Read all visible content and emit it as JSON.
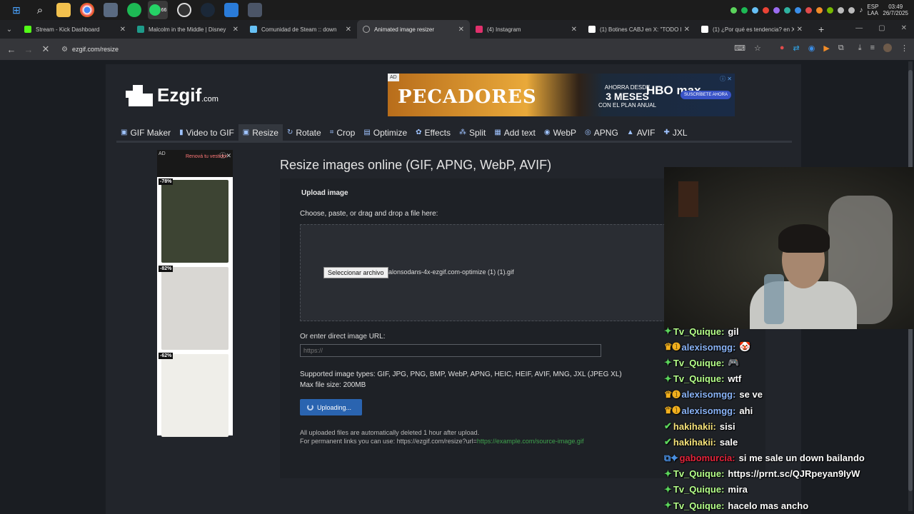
{
  "tray": {
    "lang": "ESP",
    "layout": "LAA",
    "time": "03:49",
    "date": "26/7/2025"
  },
  "taskbar_badge": "66",
  "tabs": [
    {
      "label": "Stream - Kick Dashboard",
      "color": "#53fc18"
    },
    {
      "label": "Malcolm in the Middle | Disney",
      "color": "#1e9b8a"
    },
    {
      "label": "Comunidad de Steam :: down",
      "color": "#66c0f4"
    },
    {
      "label": "Animated image resizer",
      "color": "#aaaaaa"
    },
    {
      "label": "(4) Instagram",
      "color": "#e1306c"
    },
    {
      "label": "(1) Botines CABJ en X: \"TODO I",
      "color": "#ffffff"
    },
    {
      "label": "(1) ¿Por qué es tendencia? en X",
      "color": "#ffffff"
    }
  ],
  "url": "ezgif.com/resize",
  "site": {
    "logo": "Ezgif",
    "logo_sub": ".com",
    "ad_tag": "AD",
    "ad_title": "PECADORES",
    "ad_promo_top": "AHORRA DESDE",
    "ad_promo_main": "3 MESES",
    "ad_promo_bottom": "CON EL PLAN ANUAL",
    "ad_brand": "HBO max",
    "ad_cta": "SUSCRÍBETE AHORA",
    "menu": [
      {
        "label": "GIF Maker"
      },
      {
        "label": "Video to GIF"
      },
      {
        "label": "Resize"
      },
      {
        "label": "Rotate"
      },
      {
        "label": "Crop"
      },
      {
        "label": "Optimize"
      },
      {
        "label": "Effects"
      },
      {
        "label": "Split"
      },
      {
        "label": "Add text"
      },
      {
        "label": "WebP"
      },
      {
        "label": "APNG"
      },
      {
        "label": "AVIF"
      },
      {
        "label": "JXL"
      }
    ],
    "side_ad": {
      "tag": "AD",
      "brand": "Renová tu vestidor",
      "products": [
        {
          "discount": "-78%",
          "color": "#3d4433"
        },
        {
          "discount": "-82%",
          "color": "#d9d7d3"
        },
        {
          "discount": "-62%",
          "color": "#efeee9"
        }
      ]
    },
    "page_title": "Resize images online (GIF, APNG, WebP, AVIF)",
    "upload_label": "Upload image",
    "choose_text": "Choose, paste, or drag and drop a file here:",
    "file_button": "Seleccionar archivo",
    "file_name": "alonsodans-4x-ezgif.com-optimize (1) (1).gif",
    "url_label": "Or enter direct image URL:",
    "url_placeholder": "https://",
    "supported": "Supported image types: GIF, JPG, PNG, BMP, WebP, APNG, HEIC, HEIF, AVIF, MNG, JXL (JPEG XL)",
    "max_size": "Max file size: 200MB",
    "upload_button": "Uploading...",
    "note1": "All uploaded files are automatically deleted 1 hour after upload.",
    "note2": "For permanent links you can use: https://ezgif.com/resize?url=",
    "note2_link": "https://example.com/source-image.gif"
  },
  "chat": [
    {
      "badge": "✦",
      "badge_color": "#5bd35b",
      "user": "Tv_Quique:",
      "user_color": "#b5ff8a",
      "text": "gil"
    },
    {
      "badge": "♛➊",
      "badge_color": "#f2b01e",
      "user": "alexisomgg:",
      "user_color": "#8ab4f8",
      "text": "🤡"
    },
    {
      "badge": "✦",
      "badge_color": "#5bd35b",
      "user": "Tv_Quique:",
      "user_color": "#b5ff8a",
      "text": "🎮"
    },
    {
      "badge": "✦",
      "badge_color": "#5bd35b",
      "user": "Tv_Quique:",
      "user_color": "#b5ff8a",
      "text": "wtf"
    },
    {
      "badge": "♛➊",
      "badge_color": "#f2b01e",
      "user": "alexisomgg:",
      "user_color": "#8ab4f8",
      "text": "se ve"
    },
    {
      "badge": "♛➊",
      "badge_color": "#f2b01e",
      "user": "alexisomgg:",
      "user_color": "#8ab4f8",
      "text": "ahi"
    },
    {
      "badge": "✔",
      "badge_color": "#5bd35b",
      "user": "hakihakii:",
      "user_color": "#f5e27a",
      "text": "sisi"
    },
    {
      "badge": "✔",
      "badge_color": "#5bd35b",
      "user": "hakihakii:",
      "user_color": "#f5e27a",
      "text": "sale"
    },
    {
      "badge": "⧉✦",
      "badge_color": "#4a90e2",
      "user": "gabomurcia:",
      "user_color": "#e5243b",
      "text": "si me sale un down bailando"
    },
    {
      "badge": "✦",
      "badge_color": "#5bd35b",
      "user": "Tv_Quique:",
      "user_color": "#b5ff8a",
      "text": "https://prnt.sc/QJRpeyan9IyW"
    },
    {
      "badge": "✦",
      "badge_color": "#5bd35b",
      "user": "Tv_Quique:",
      "user_color": "#b5ff8a",
      "text": "mira"
    },
    {
      "badge": "✦",
      "badge_color": "#5bd35b",
      "user": "Tv_Quique:",
      "user_color": "#b5ff8a",
      "text": "hacelo mas ancho"
    }
  ]
}
